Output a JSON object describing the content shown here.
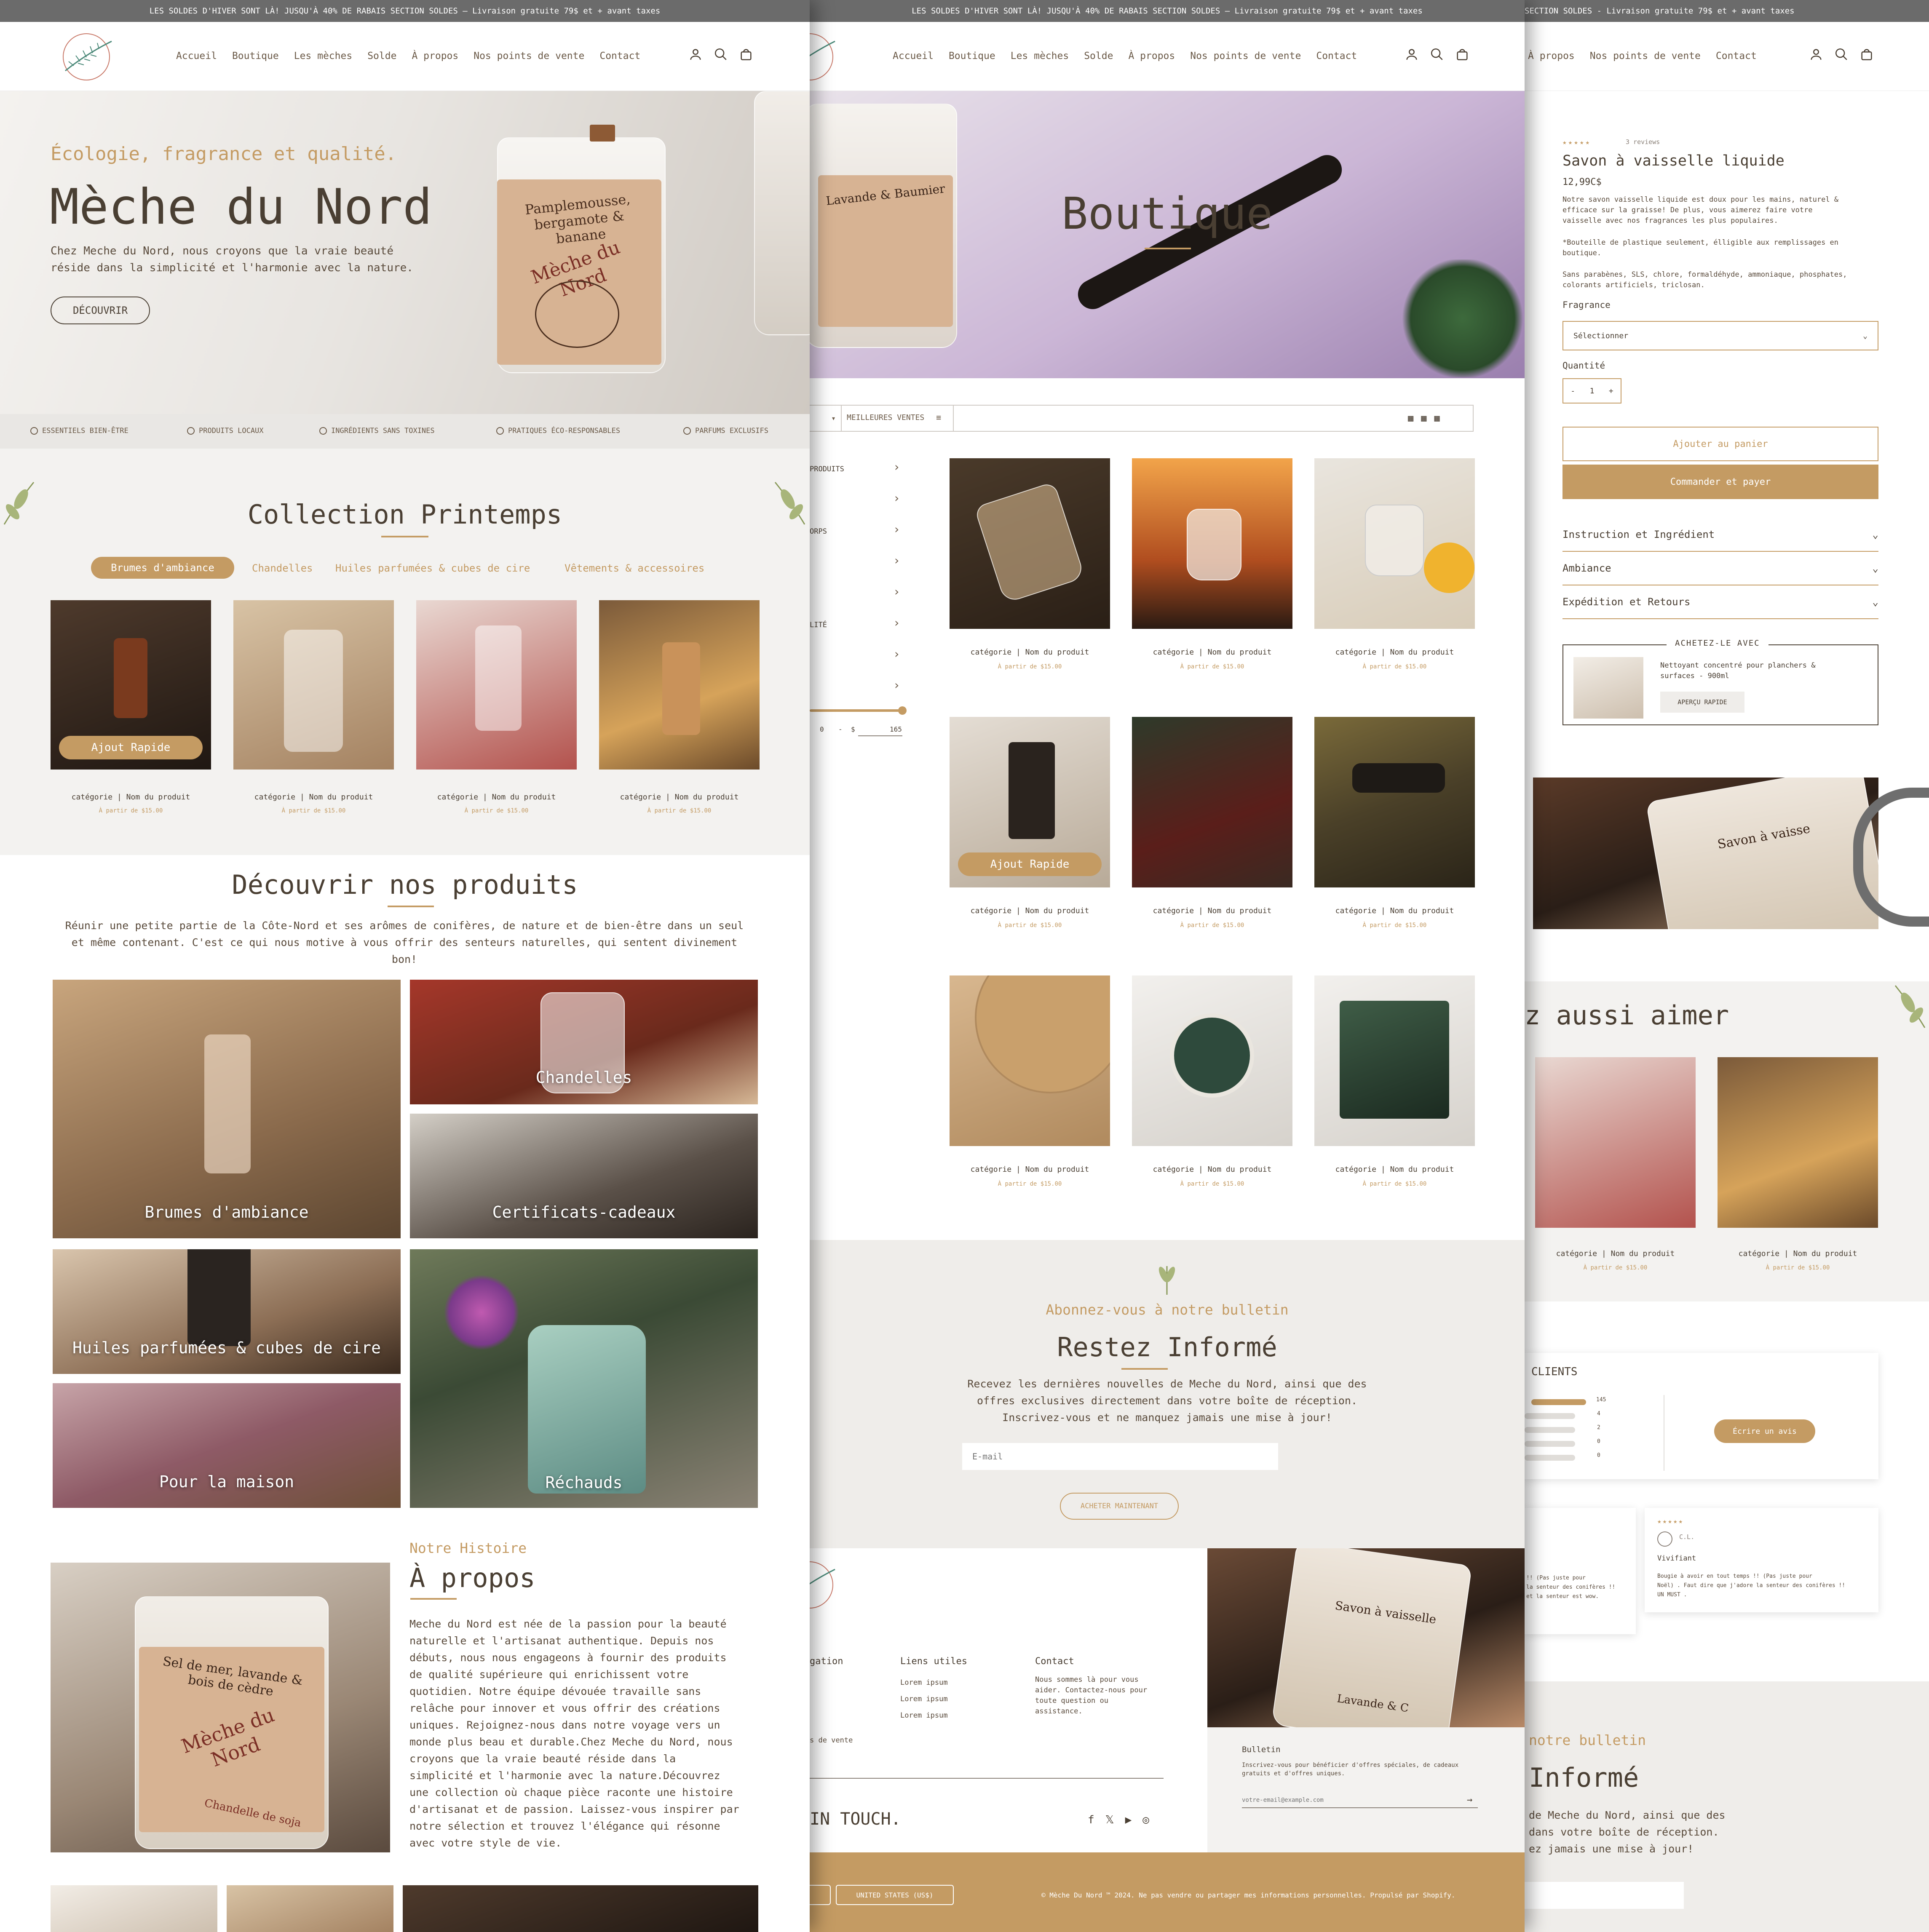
{
  "announcement": "LES SOLDES D'HIVER SONT LÀ! JUSQU'À 40% DE RABAIS SECTION SOLDES – Livraison gratuite 79$ et + avant taxes",
  "announcement_p3": "SECTION SOLDES - Livraison gratuite 79$ et + avant taxes",
  "nav": [
    "Accueil",
    "Boutique",
    "Les mèches",
    "Solde",
    "À propos",
    "Nos points de vente",
    "Contact"
  ],
  "nav_p3": [
    "À propos",
    "Nos points de vente",
    "Contact"
  ],
  "home": {
    "hero_kicker": "Écologie, fragrance et qualité.",
    "hero_title": "Mèche du Nord",
    "hero_text_1": "Chez Meche du Nord, nous croyons que la vraie beauté",
    "hero_text_2": "réside dans la simplicité et l'harmonie avec la nature.",
    "hero_button": "DÉCOUVRIR",
    "jar_label": "Pamplemousse, bergamote & banane",
    "jar_brand": "Mèche du Nord",
    "features": [
      "ESSENTIELS BIEN-ÊTRE",
      "PRODUITS LOCAUX",
      "INGRÉDIENTS SANS TOXINES",
      "PRATIQUES ÉCO-RESPONSABLES",
      "PARFUMS EXCLUSIFS"
    ],
    "collection_title": "Collection Printemps",
    "collection_tabs": [
      "Brumes d'ambiance",
      "Chandelles",
      "Huiles parfumées & cubes de cire",
      "Vêtements & accessoires"
    ],
    "quick_add": "Ajout Rapide",
    "product_name": "catégorie | Nom du produit",
    "product_price": "À partir de $15.00",
    "discover_title": "Découvrir nos produits",
    "discover_text_1": "Réunir une petite partie de la Côte-Nord et ses arômes de conifères, de nature et de bien-être dans un seul",
    "discover_text_2": "et même contenant. C'est ce qui nous motive à vous offrir des senteurs naturelles, qui sentent divinement",
    "discover_text_3": "bon!",
    "tiles": [
      "Brumes d'ambiance",
      "Chandelles",
      "Certificats-cadeaux",
      "Huiles parfumées & cubes de cire",
      "Pour la maison",
      "Réchauds"
    ],
    "about_kicker": "Notre Histoire",
    "about_title": "À propos",
    "about_text": [
      "Meche du Nord est née de la passion pour la beauté",
      "naturelle et l'artisanat authentique. Depuis nos",
      "débuts, nous nous engageons à fournir des produits",
      "de qualité supérieure qui enrichissent votre",
      "quotidien. Notre équipe dévouée travaille sans",
      "relâche pour innover et vous offrir des créations",
      "uniques. Rejoignez-nous dans notre voyage vers un",
      "monde plus beau et durable.Chez Meche du Nord, nous",
      "croyons que la vraie beauté réside dans la",
      "simplicité et l'harmonie avec la nature.Découvrez",
      "une collection où chaque pièce raconte une histoire",
      "d'artisanat et de passion. Laissez-vous inspirer par",
      "notre sélection et trouvez l'élégance qui résonne",
      "avec votre style de vie."
    ],
    "about_jar_label": "Sel de mer, lavande & bois de cèdre",
    "about_jar_sub": "Chandelle de soja"
  },
  "shop": {
    "title": "Boutique",
    "hero_jar_label": "Lavande & Baumier",
    "sort_label": "MEILLEURES VENTES",
    "filters": [
      "PRODUITS",
      "",
      "ORPS",
      "",
      "LITÉ",
      "",
      ""
    ],
    "price_from": "0",
    "price_currency": "$",
    "price_to": "165",
    "quick_add": "Ajout Rapide",
    "product_name": "catégorie | Nom du produit",
    "product_price": "À partir de $15.00",
    "newsletter_kicker": "Abonnez-vous à notre bulletin",
    "newsletter_title": "Restez Informé",
    "newsletter_text_1": "Recevez les dernières nouvelles de Meche du Nord, ainsi que des",
    "newsletter_text_2": "offres exclusives directement dans votre boîte de réception.",
    "newsletter_text_3": "Inscrivez-vous et ne manquez jamais une mise à jour!",
    "email_placeholder": "E-mail",
    "newsletter_button": "ACHETER MAINTENANT",
    "footer_nav_title": "gation",
    "footer_nav_item": "s de vente",
    "footer_links_title": "Liens utiles",
    "footer_links": [
      "Lorem ipsum",
      "Lorem ipsum",
      "Lorem ipsum"
    ],
    "footer_contact_title": "Contact",
    "footer_contact_text": [
      "Nous sommes là pour vous",
      "aider. Contactez-nous pour",
      "toute question ou",
      "assistance."
    ],
    "footer_bulletin_title": "Bulletin",
    "footer_bulletin_text_1": "Inscrivez-vous pour bénéficier d'offres spéciales, de cadeaux",
    "footer_bulletin_text_2": "gratuits et d'offres uniques.",
    "footer_email_placeholder": "votre-email@example.com",
    "footer_image_label": "Savon à vaisselle",
    "footer_image_sub": "Lavande & C",
    "touch": "IN TOUCH.",
    "currency_select": "UNITED STATES (US$)",
    "copyright": "© Mèche Du Nord ™ 2024. Ne pas vendre ou partager mes informations personnelles. Propulsé par Shopify."
  },
  "product": {
    "reviews_count": "3 reviews",
    "rating": 5,
    "title": "Savon à vaisselle liquide",
    "price": "12,99C$",
    "desc_1": "Notre savon vaisselle liquide est doux pour les mains, naturel &",
    "desc_2": "efficace sur la graisse! De plus,  vous aimerez faire votre",
    "desc_3": "vaisselle avec nos fragrances les plus populaires.",
    "note_1": "*Bouteille de plastique seulement, élligible aux remplissages en",
    "note_2": "boutique.",
    "free_1": "Sans parabènes, SLS, chlore, formaldéhyde, ammoniaque, phosphates,",
    "free_2": "colorants artificiels, triclosan.",
    "fragrance_label": "Fragrance",
    "fragrance_value": "Sélectionner",
    "qty_label": "Quantité",
    "qty_minus": "-",
    "qty_value": "1",
    "qty_plus": "+",
    "add_to_cart": "Ajouter au panier",
    "buy_now": "Commander et payer",
    "accordions": [
      "Instruction et Ingrédient",
      "Ambiance",
      "Expédition et Retours"
    ],
    "pair_title": "ACHETEZ-LE AVEC",
    "pair_text_1": "Nettoyant concentré pour planchers &",
    "pair_text_2": "surfaces - 900ml",
    "pair_button": "APERÇU RAPIDE",
    "image_label": "Savon à vaisse",
    "related_title": "z aussi aimer",
    "product_name": "catégorie | Nom du produit",
    "product_price": "À partir de $15.00",
    "reviews_title": "CLIENTS",
    "bar_counts": [
      "145",
      "4",
      "2",
      "0",
      "0"
    ],
    "write_review": "Écrire un avis",
    "review1_1": "!! (Pas juste pour",
    "review1_2": "la senteur des conifères !!",
    "review1_3": "et la senteur est wow.",
    "review2_author": "C.L.",
    "review2_title": "Vivifiant",
    "review2_1": "Bougie à avoir en tout temps !! (Pas juste pour",
    "review2_2": "Noël) . Faut dire que j'adore la senteur des conifères !!",
    "review2_3": "UN MUST .",
    "newsletter_kicker": "notre bulletin",
    "newsletter_title": "Informé",
    "newsletter_text_1": "de Meche du Nord, ainsi que des",
    "newsletter_text_2": "dans votre boîte de réception.",
    "newsletter_text_3": "ez jamais une mise à jour!"
  },
  "colors": {
    "gold": "#c49b63",
    "brown": "#4a3f33",
    "grey_bar": "#6b6b6b",
    "footer_gold": "#c49b63"
  }
}
